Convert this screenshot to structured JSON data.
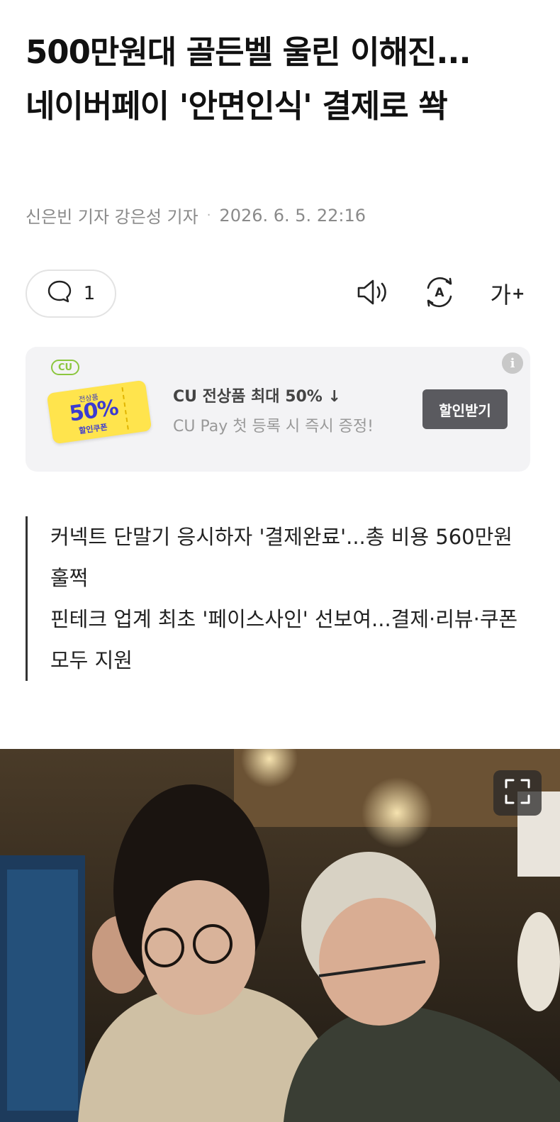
{
  "article": {
    "headline": "500만원대 골든벨 울린 이해진...네이버페이 '안면인식' 결제로 쏵",
    "byline_authors": "신은빈 기자 강은성 기자",
    "byline_separator": "·",
    "byline_date": "2026. 6. 5. 22:16"
  },
  "toolbar": {
    "comment_count": "1",
    "font_size_label": "가",
    "font_size_plus": "+",
    "speaker_icon": "speaker-icon",
    "translate_icon": "translate-icon"
  },
  "ad": {
    "brand": "CU",
    "coupon_small": "전상품",
    "coupon_big": "50%",
    "coupon_label": "할인쿠폰",
    "title": "CU 전상품 최대 50% ↓",
    "subtitle": "CU Pay 첫 등록 시 즉시 증정!",
    "cta": "할인받기",
    "info": "i"
  },
  "summary": {
    "lines": [
      "커넥트 단말기 응시하자 '결제완료'...총 비용 560만원 훌쩍",
      "핀테크 업계 최초 '페이스사인' 선보여...결제·리뷰·쿠폰 모두 지원"
    ]
  },
  "photo": {
    "expand_icon": "expand-icon"
  },
  "colors": {
    "ad_bg": "#f3f3f5",
    "cu_green": "#8cc63f",
    "coupon_yellow": "#ffe44d",
    "cta_bg": "#5a5a5f"
  }
}
